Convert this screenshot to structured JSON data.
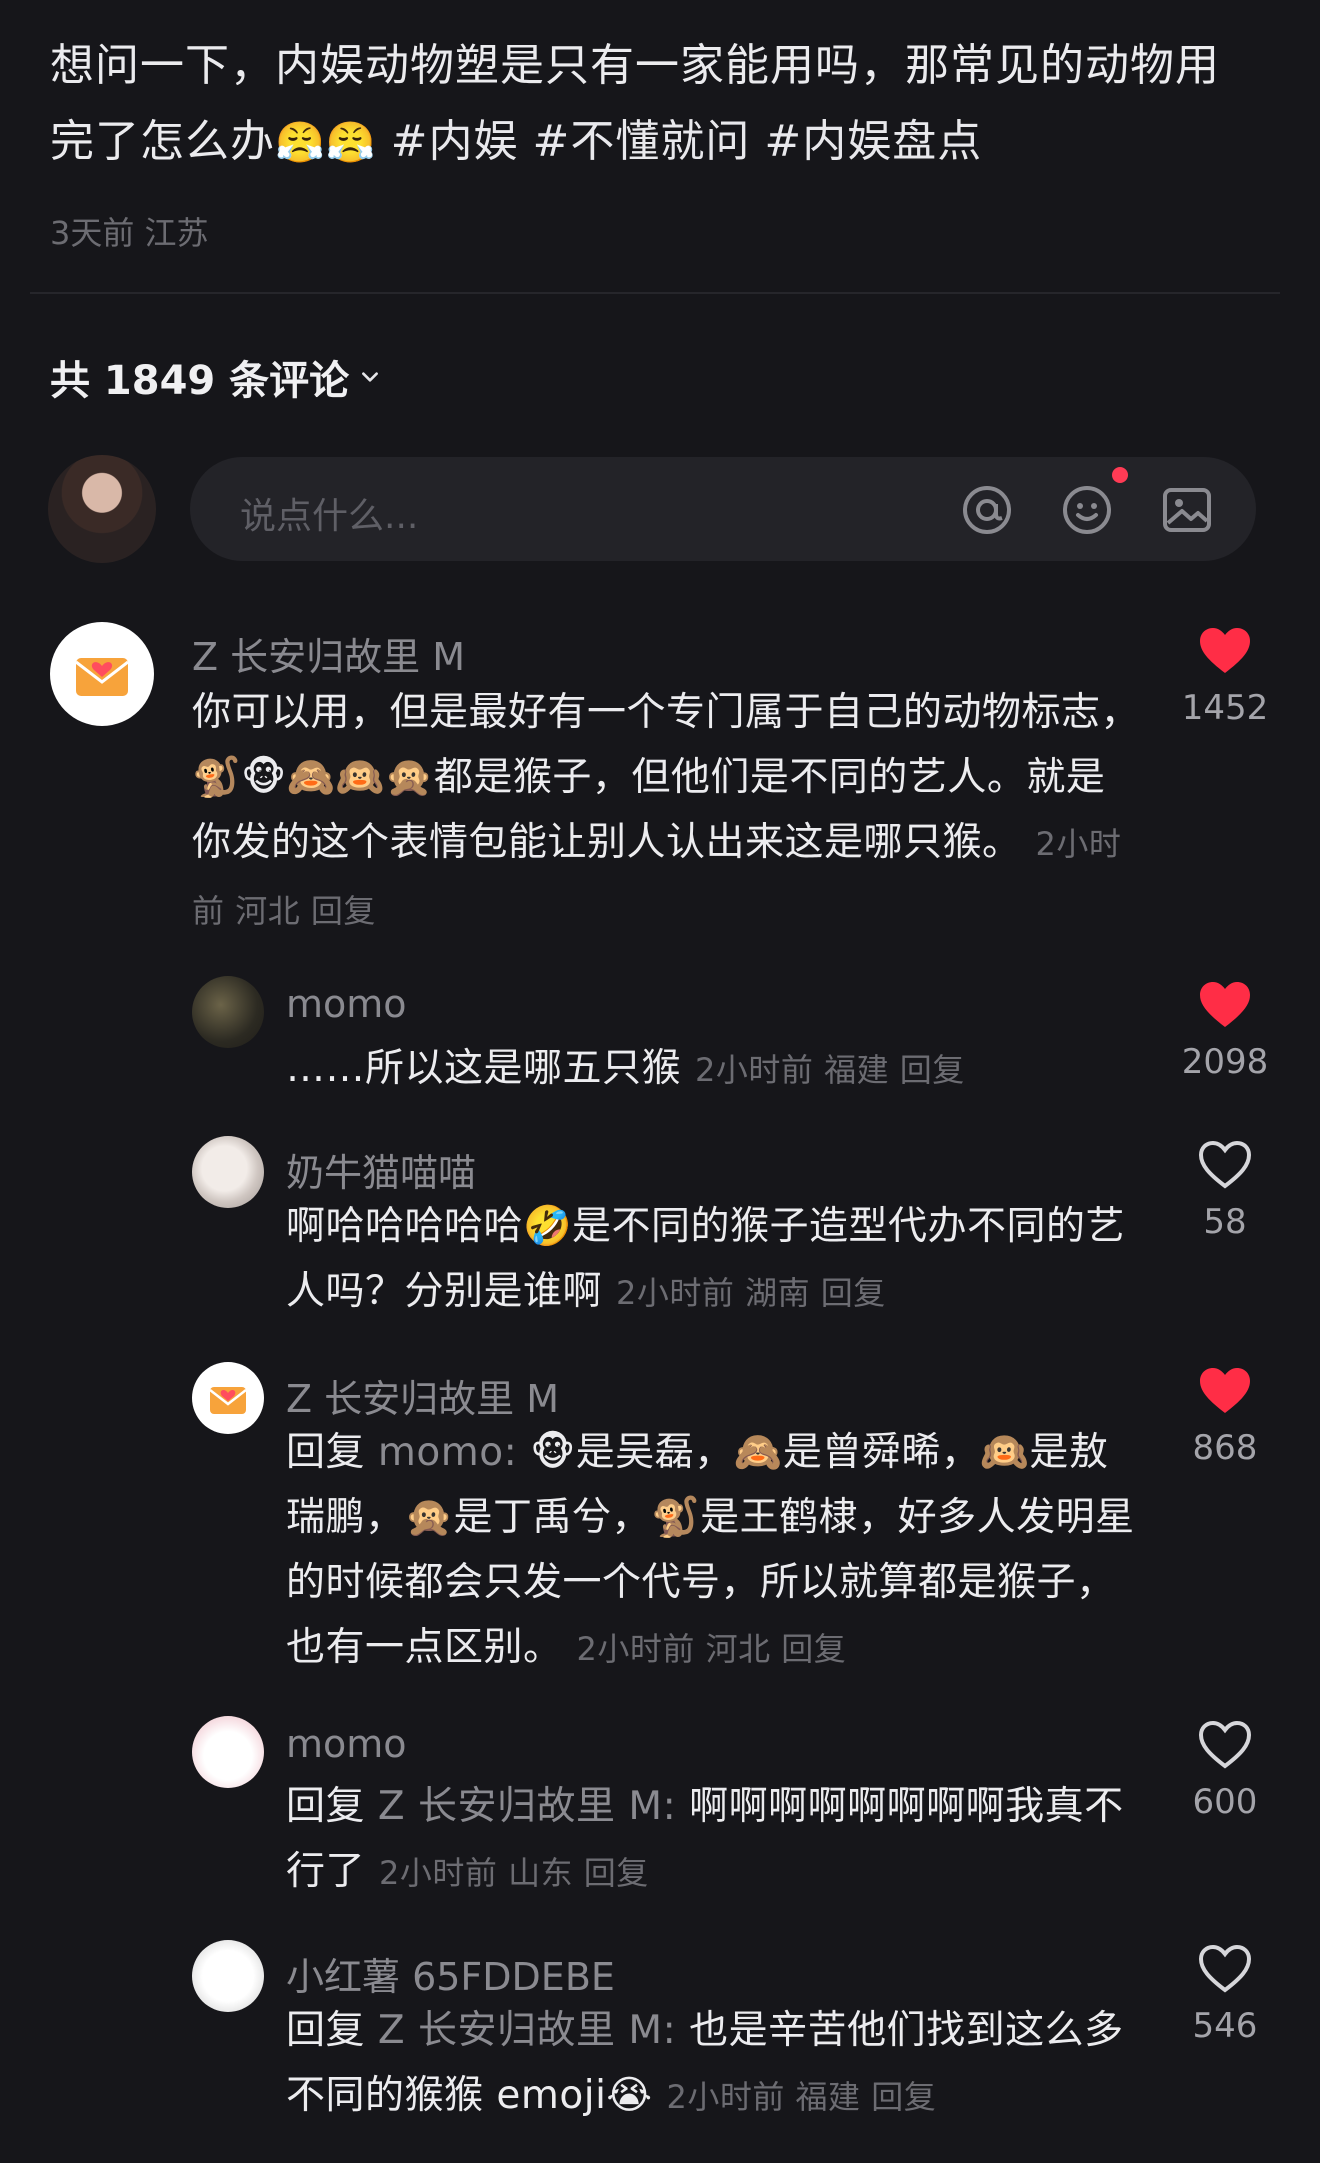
{
  "post": {
    "text": "想问一下，内娱动物塑是只有一家能用吗，那常见的动物用完了怎么办",
    "emojis": "😤😤",
    "tags": [
      "#内娱",
      "#不懂就问",
      "#内娱盘点"
    ],
    "time": "3天前",
    "location": "江苏"
  },
  "comments_header": {
    "label": "共 1849 条评论"
  },
  "input": {
    "placeholder": "说点什么..."
  },
  "icons": {
    "mention": "at-icon",
    "emoji": "smiley-icon",
    "image": "image-icon",
    "like": "heart-icon"
  },
  "colors": {
    "background": "#16161a",
    "liked": "#ff2d46",
    "muted": "#8a8a90"
  },
  "comments": [
    {
      "name": "Z 长安归故里 M",
      "body": "你可以用，但是最好有一个专门属于自己的动物标志，🐒🐵🙈🙉🙊都是猴子，但他们是不同的艺人。就是你发的这个表情包能让别人认出来这是哪只猴。",
      "time": "2小时前",
      "location": "河北",
      "reply": "回复",
      "likes": "1452",
      "liked": true
    },
    {
      "name": "momo",
      "body": "……所以这是哪五只猴",
      "time": "2小时前",
      "location": "福建",
      "reply": "回复",
      "likes": "2098",
      "liked": true
    },
    {
      "name": "奶牛猫喵喵",
      "body": "啊哈哈哈哈哈🤣是不同的猴子造型代办不同的艺人吗？分别是谁啊",
      "time": "2小时前",
      "location": "湖南",
      "reply": "回复",
      "likes": "58",
      "liked": false
    },
    {
      "name": "Z 长安归故里 M",
      "reply_prefix": "回复",
      "reply_target": "momo:",
      "body": "🐵是吴磊，🙈是曾舜晞，🙉是敖瑞鹏，🙊是丁禹兮，🐒是王鹤棣，好多人发明星的时候都会只发一个代号，所以就算都是猴子，也有一点区别。",
      "time": "2小时前",
      "location": "河北",
      "reply": "回复",
      "likes": "868",
      "liked": true
    },
    {
      "name": "momo",
      "reply_prefix": "回复",
      "reply_target": "Z 长安归故里 M:",
      "body": "啊啊啊啊啊啊啊啊我真不行了",
      "time": "2小时前",
      "location": "山东",
      "reply": "回复",
      "likes": "600",
      "liked": false
    },
    {
      "name": "小红薯 65FDDEBE",
      "reply_prefix": "回复",
      "reply_target": "Z 长安归故里 M:",
      "body": "也是辛苦他们找到这么多不同的猴猴 emoji😭",
      "time": "2小时前",
      "location": "福建",
      "reply": "回复",
      "likes": "546",
      "liked": false
    }
  ]
}
